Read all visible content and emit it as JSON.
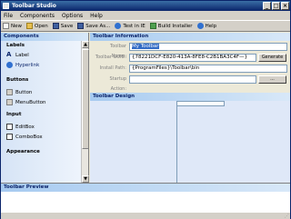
{
  "window": {
    "title": "Toolbar Studio"
  },
  "title_buttons": {
    "minimize": "_",
    "maximize": "□",
    "close": "×"
  },
  "menu": [
    "File",
    "Components",
    "Options",
    "Help"
  ],
  "toolbar": [
    {
      "label": "New",
      "icon": "new-icon",
      "color": "#f0f0f0"
    },
    {
      "label": "Open",
      "icon": "open-icon",
      "color": "#e8c050"
    },
    {
      "label": "Save",
      "icon": "save-icon",
      "color": "#4060a0"
    },
    {
      "label": "Save As...",
      "icon": "save-as-icon",
      "color": "#4060a0"
    },
    {
      "label": "Test in IE",
      "icon": "ie-icon",
      "color": "#3070d0"
    },
    {
      "label": "Build Installer",
      "icon": "build-icon",
      "color": "#50a050"
    },
    {
      "label": "Help",
      "icon": "help-icon",
      "color": "#3070d0"
    }
  ],
  "components": {
    "header": "Components",
    "categories": [
      {
        "name": "Labels",
        "items": [
          {
            "label": "Label",
            "icon": "label-icon"
          },
          {
            "label": "Hyperlink",
            "icon": "hyperlink-icon"
          }
        ]
      },
      {
        "name": "Buttons",
        "items": [
          {
            "label": "Button",
            "icon": "button-icon"
          },
          {
            "label": "MenuButton",
            "icon": "menubutton-icon"
          }
        ]
      },
      {
        "name": "Input",
        "items": [
          {
            "label": "EditBox",
            "icon": "editbox-icon"
          },
          {
            "label": "ComboBox",
            "icon": "combobox-icon"
          }
        ]
      },
      {
        "name": "Appearance",
        "items": []
      }
    ]
  },
  "info": {
    "header": "Toolbar Information",
    "toolbar_name_label": "Toolbar Name:",
    "toolbar_name_value": "My Toolbar",
    "toolbar_guid_label": "Toolbar GUID:",
    "toolbar_guid_value": "{78221DCF-E820-413A-8FE8-C2B1BA3C4F—}",
    "generate_button": "Generate",
    "install_path_label": "Install Path:",
    "install_path_value": "{ProgramFiles}\\Toolbar\\bin",
    "startup_action_label": "Startup Action:",
    "startup_action_value": "",
    "browse_button": "..."
  },
  "design": {
    "header": "Toolbar Design"
  },
  "preview": {
    "header": "Toolbar Preview"
  }
}
